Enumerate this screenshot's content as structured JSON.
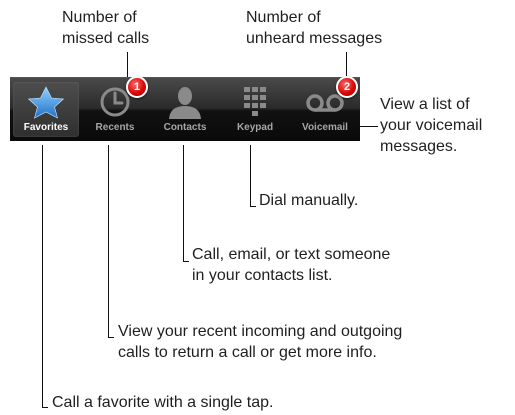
{
  "callouts": {
    "missed_calls": "Number of\nmissed calls",
    "unheard_messages": "Number of\nunheard messages",
    "voicemail_list": "View a list of\nyour voicemail\nmessages.",
    "dial_manually": "Dial manually.",
    "contacts": "Call, email, or text someone\nin your contacts list.",
    "recents": "View your recent incoming and outgoing\ncalls to return a call or get more info.",
    "favorites": "Call a favorite with a single tap."
  },
  "tabbar": {
    "tabs": [
      {
        "label": "Favorites",
        "icon": "star-icon",
        "active": true
      },
      {
        "label": "Recents",
        "icon": "clock-icon",
        "badge": "1"
      },
      {
        "label": "Contacts",
        "icon": "person-icon"
      },
      {
        "label": "Keypad",
        "icon": "keypad-icon"
      },
      {
        "label": "Voicemail",
        "icon": "voicemail-icon",
        "badge": "2"
      }
    ]
  },
  "colors": {
    "star": "#2f8fe0",
    "badge": "#d40000",
    "icon_inactive": "#8a8a8a"
  }
}
